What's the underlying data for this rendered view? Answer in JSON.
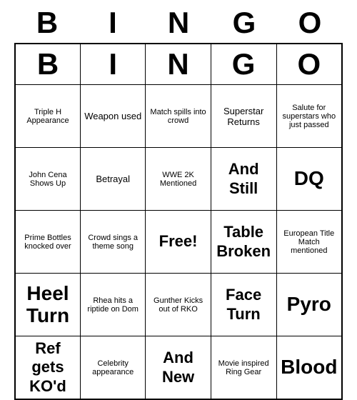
{
  "title": {
    "letters": [
      "B",
      "I",
      "N",
      "G",
      "O"
    ]
  },
  "grid": [
    [
      {
        "text": "Triple H Appearance",
        "size": "small"
      },
      {
        "text": "Weapon used",
        "size": "medium"
      },
      {
        "text": "Match spills into crowd",
        "size": "small"
      },
      {
        "text": "Superstar Returns",
        "size": "medium"
      },
      {
        "text": "Salute for superstars who just passed",
        "size": "small"
      }
    ],
    [
      {
        "text": "John Cena Shows Up",
        "size": "small"
      },
      {
        "text": "Betrayal",
        "size": "medium"
      },
      {
        "text": "WWE 2K Mentioned",
        "size": "small"
      },
      {
        "text": "And Still",
        "size": "large"
      },
      {
        "text": "DQ",
        "size": "xlarge"
      }
    ],
    [
      {
        "text": "Prime Bottles knocked over",
        "size": "small"
      },
      {
        "text": "Crowd sings a theme song",
        "size": "small"
      },
      {
        "text": "Free!",
        "size": "large"
      },
      {
        "text": "Table Broken",
        "size": "large"
      },
      {
        "text": "European Title Match mentioned",
        "size": "small"
      }
    ],
    [
      {
        "text": "Heel Turn",
        "size": "xlarge"
      },
      {
        "text": "Rhea hits a riptide on Dom",
        "size": "small"
      },
      {
        "text": "Gunther Kicks out of RKO",
        "size": "small"
      },
      {
        "text": "Face Turn",
        "size": "large"
      },
      {
        "text": "Pyro",
        "size": "xlarge"
      }
    ],
    [
      {
        "text": "Ref gets KO'd",
        "size": "large"
      },
      {
        "text": "Celebrity appearance",
        "size": "small"
      },
      {
        "text": "And New",
        "size": "large"
      },
      {
        "text": "Movie inspired Ring Gear",
        "size": "small"
      },
      {
        "text": "Blood",
        "size": "xlarge"
      }
    ]
  ]
}
